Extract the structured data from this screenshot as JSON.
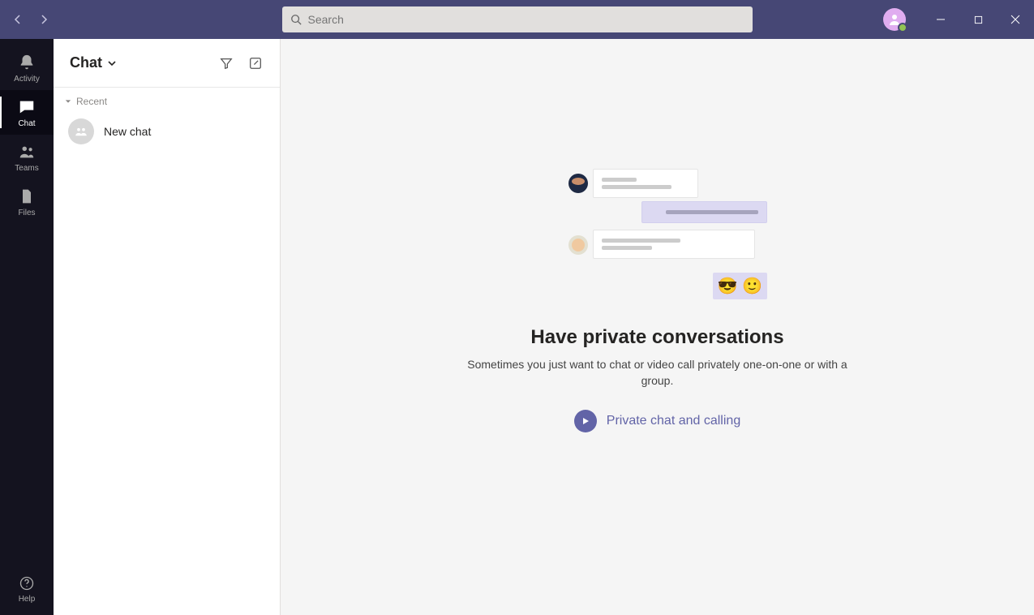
{
  "titlebar": {
    "search_placeholder": "Search"
  },
  "rail": {
    "items": [
      {
        "label": "Activity"
      },
      {
        "label": "Chat"
      },
      {
        "label": "Teams"
      },
      {
        "label": "Files"
      }
    ],
    "help_label": "Help"
  },
  "list": {
    "title": "Chat",
    "section_label": "Recent",
    "items": [
      {
        "label": "New chat"
      }
    ]
  },
  "main": {
    "empty_title": "Have private conversations",
    "empty_subtitle": "Sometimes you just want to chat or video call privately one-on-one or with a group.",
    "cta_label": "Private chat and calling"
  }
}
